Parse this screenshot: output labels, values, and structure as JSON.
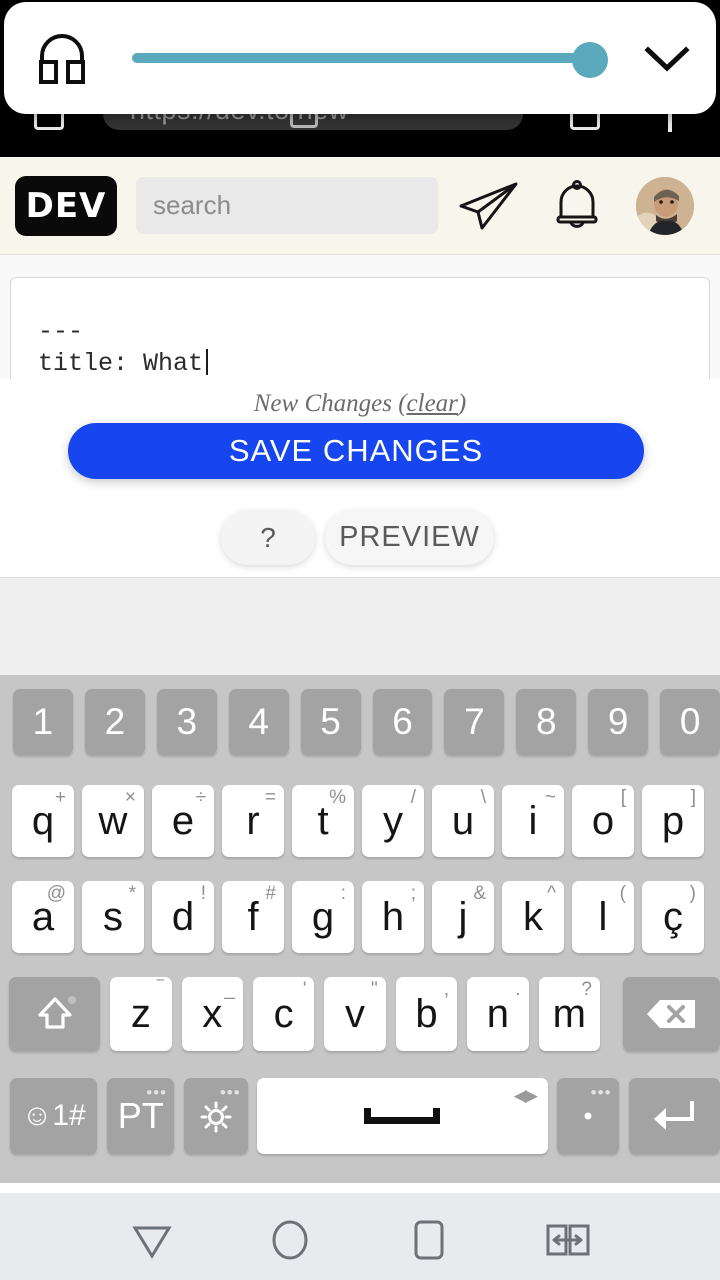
{
  "volume_panel": {
    "icon": "headphones-icon",
    "slider_value": 97,
    "slider_min": 0,
    "slider_max": 100,
    "expand_icon": "chevron-down-icon",
    "track_color": "#5aa9bc"
  },
  "browser": {
    "url_text": "https://dev.to/new",
    "tabs_icon": "tabs-icon",
    "window_icon": "window-icon"
  },
  "devnav": {
    "logo_text": "DEV",
    "search_placeholder": "search",
    "search_value": "",
    "send_icon": "paper-plane-icon",
    "bell_icon": "bell-icon",
    "avatar": "user-avatar",
    "bg_color": "#f7f5ec"
  },
  "editor": {
    "line1": "---",
    "line2": "title: What",
    "has_caret": true
  },
  "actions": {
    "status_prefix": "New Changes (",
    "clear_label": "clear",
    "status_suffix": ")",
    "save_label": "SAVE CHANGES",
    "help_label": "?",
    "preview_label": "PREVIEW",
    "save_color": "#1745f0"
  },
  "keyboard": {
    "language": "PT",
    "rows": {
      "numbers": [
        {
          "main": "1"
        },
        {
          "main": "2"
        },
        {
          "main": "3"
        },
        {
          "main": "4"
        },
        {
          "main": "5"
        },
        {
          "main": "6"
        },
        {
          "main": "7"
        },
        {
          "main": "8"
        },
        {
          "main": "9"
        },
        {
          "main": "0"
        }
      ],
      "top": [
        {
          "main": "q",
          "sup": "+"
        },
        {
          "main": "w",
          "sup": "×"
        },
        {
          "main": "e",
          "sup": "÷"
        },
        {
          "main": "r",
          "sup": "="
        },
        {
          "main": "t",
          "sup": "%"
        },
        {
          "main": "y",
          "sup": "/"
        },
        {
          "main": "u",
          "sup": "\\"
        },
        {
          "main": "i",
          "sup": "~"
        },
        {
          "main": "o",
          "sup": "["
        },
        {
          "main": "p",
          "sup": "]"
        }
      ],
      "home": [
        {
          "main": "a",
          "sup": "@"
        },
        {
          "main": "s",
          "sup": "*"
        },
        {
          "main": "d",
          "sup": "!"
        },
        {
          "main": "f",
          "sup": "#"
        },
        {
          "main": "g",
          "sup": ":"
        },
        {
          "main": "h",
          "sup": ";"
        },
        {
          "main": "j",
          "sup": "&"
        },
        {
          "main": "k",
          "sup": "^"
        },
        {
          "main": "l",
          "sup": "("
        },
        {
          "main": "ç",
          "sup": ")"
        }
      ],
      "bottom": [
        {
          "main": "z",
          "sup": "‾"
        },
        {
          "main": "x",
          "sup": "_"
        },
        {
          "main": "c",
          "sup": "'"
        },
        {
          "main": "v",
          "sup": "\""
        },
        {
          "main": "b",
          "sup": ","
        },
        {
          "main": "n",
          "sup": "."
        },
        {
          "main": "m",
          "sup": "?"
        }
      ]
    },
    "shift_icon": "shift-icon",
    "backspace_icon": "backspace-icon",
    "symbols_label": "☺1#",
    "gear_icon": "gear-icon",
    "space_icon": "space-bar-icon",
    "period_label": ".",
    "enter_icon": "enter-icon",
    "dots_label": "•••"
  },
  "navbar": {
    "back_icon": "back-triangle-icon",
    "home_icon": "home-circle-icon",
    "recents_icon": "recents-square-icon",
    "switch_icon": "switch-app-icon"
  }
}
